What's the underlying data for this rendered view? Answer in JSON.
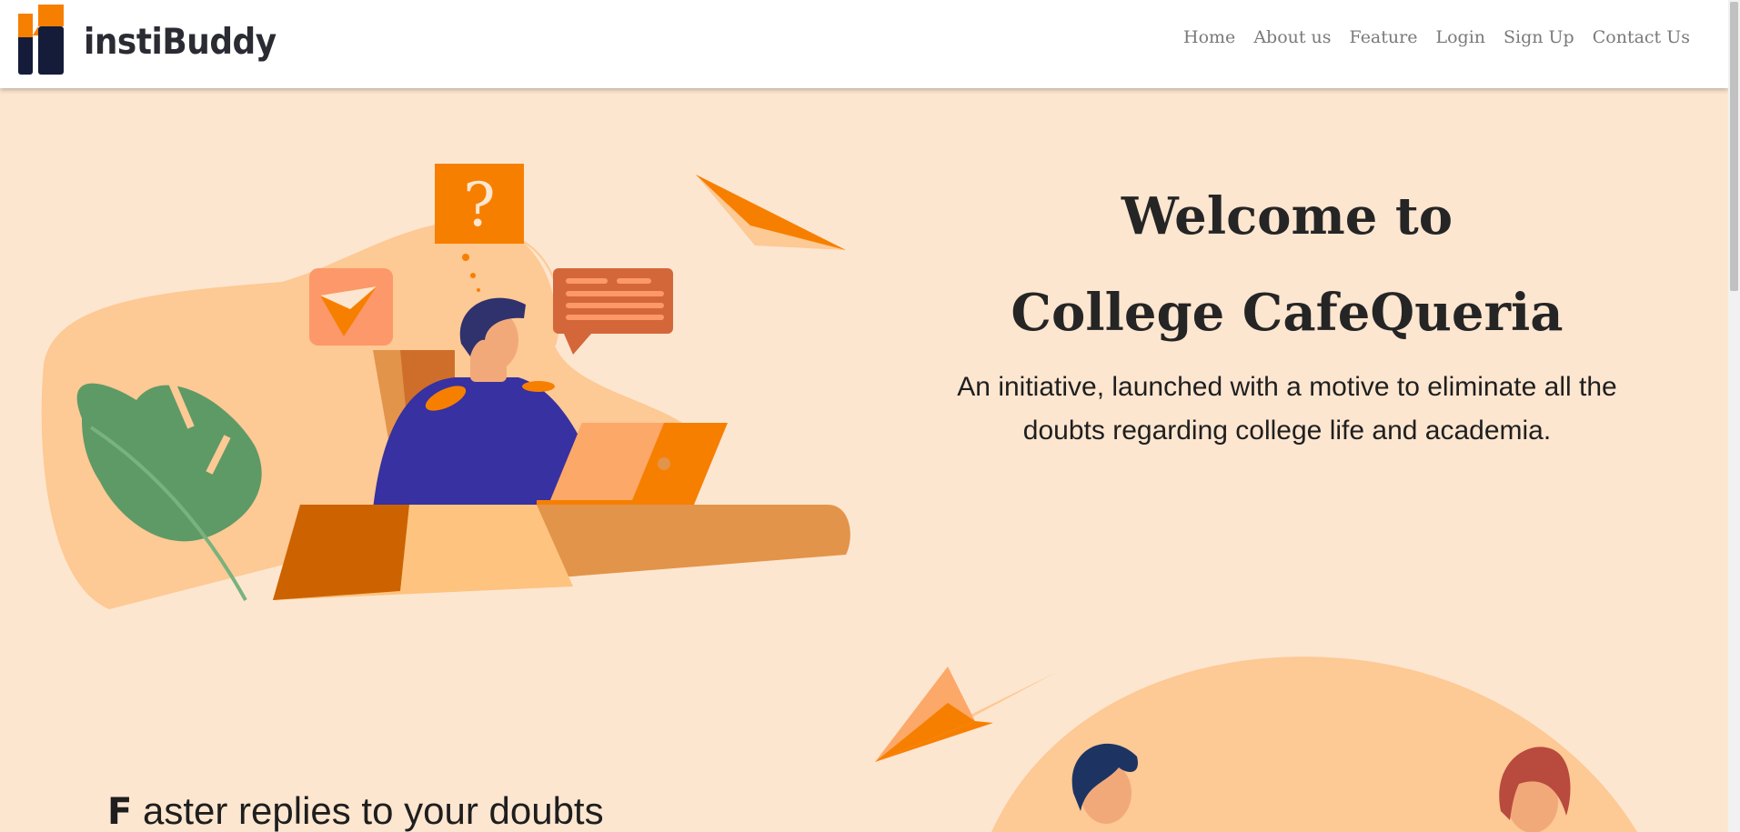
{
  "brand": {
    "name": "instiBuddy"
  },
  "nav": {
    "items": [
      {
        "label": "Home"
      },
      {
        "label": "About us"
      },
      {
        "label": "Feature"
      },
      {
        "label": "Login"
      },
      {
        "label": "Sign Up"
      },
      {
        "label": "Contact Us"
      }
    ]
  },
  "hero": {
    "title_line1": "Welcome to",
    "title_line2": "College CafeQueria",
    "subtitle_line1": "An initiative, launched with a motive to eliminate all the",
    "subtitle_line2": "doubts regarding college life and academia."
  },
  "features": {
    "first_letter": "F",
    "first_rest": " aster replies to your doubts"
  },
  "colors": {
    "background": "#fde6d0",
    "accent": "#f77f00",
    "blob": "#fdc994",
    "navy": "#141c3a"
  },
  "icons": {
    "question": "question-mark-icon",
    "send": "paper-plane-icon",
    "chat": "chat-bubble-icon"
  }
}
